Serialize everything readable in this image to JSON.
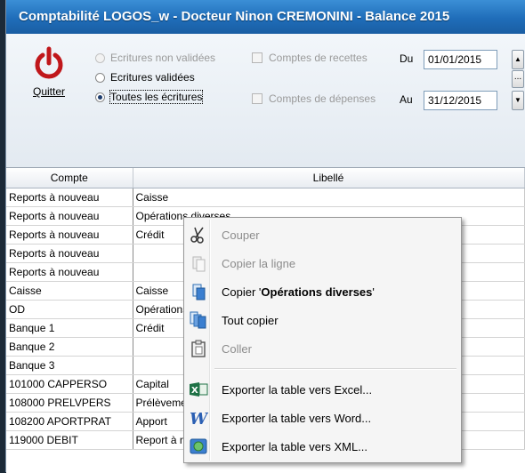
{
  "window": {
    "title": "Comptabilité LOGOS_w - Docteur Ninon CREMONINI - Balance 2015"
  },
  "toolbar": {
    "quit_label": "Quitter",
    "radio_nonvalid": "Ecritures non validées",
    "radio_valid": "Ecritures validées",
    "radio_all": "Toutes les écritures",
    "check_recettes": "Comptes de recettes",
    "check_depenses": "Comptes de dépenses",
    "du_label": "Du",
    "au_label": "Au",
    "date_from": "01/01/2015",
    "date_to": "31/12/2015",
    "ellipsis": "..."
  },
  "grid": {
    "columns": [
      "Compte",
      "Libellé"
    ],
    "rows": [
      [
        "Reports à nouveau",
        "Caisse"
      ],
      [
        "Reports à nouveau",
        "Opérations diverses"
      ],
      [
        "Reports à nouveau",
        "Crédit"
      ],
      [
        "Reports à nouveau",
        ""
      ],
      [
        "Reports à nouveau",
        ""
      ],
      [
        "Caisse",
        "Caisse"
      ],
      [
        "OD",
        "Opérations diverses"
      ],
      [
        "Banque 1",
        "Crédit"
      ],
      [
        "Banque 2",
        ""
      ],
      [
        "Banque 3",
        ""
      ],
      [
        "101000 CAPPERSO",
        "Capital"
      ],
      [
        "108000 PRELVPERS",
        "Prélèvements"
      ],
      [
        "108200 APORTPRAT",
        "Apport"
      ],
      [
        "119000 DEBIT",
        "Report à nouveau Débit"
      ]
    ]
  },
  "context_menu": {
    "cut": "Couper",
    "copy_line": "Copier la ligne",
    "copy_cell_prefix": "Copier '",
    "copy_cell_value": "Opérations diverses",
    "copy_cell_suffix": "'",
    "copy_all": "Tout copier",
    "paste": "Coller",
    "export_excel": "Exporter la table vers Excel...",
    "export_word": "Exporter la table vers Word...",
    "export_xml": "Exporter la table vers XML..."
  }
}
